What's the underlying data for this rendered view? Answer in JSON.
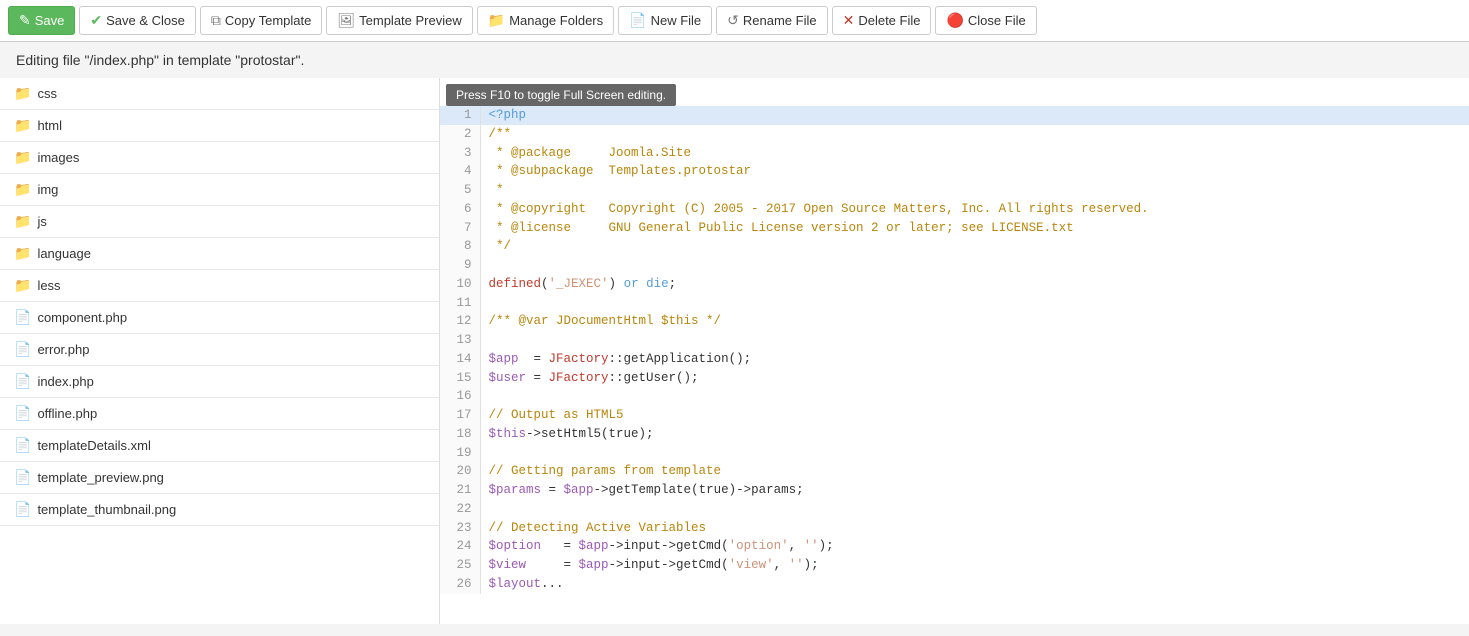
{
  "toolbar": {
    "save_label": "Save",
    "save_close_label": "Save & Close",
    "copy_template_label": "Copy Template",
    "template_preview_label": "Template Preview",
    "manage_folders_label": "Manage Folders",
    "new_file_label": "New File",
    "rename_file_label": "Rename File",
    "delete_file_label": "Delete File",
    "close_file_label": "Close File"
  },
  "editing_info": "Editing file \"/index.php\" in template \"protostar\".",
  "editor_hint": "Press F10 to toggle Full Screen editing.",
  "sidebar": {
    "folders": [
      {
        "name": "css"
      },
      {
        "name": "html"
      },
      {
        "name": "images"
      },
      {
        "name": "img"
      },
      {
        "name": "js"
      },
      {
        "name": "language"
      },
      {
        "name": "less"
      }
    ],
    "files": [
      {
        "name": "component.php"
      },
      {
        "name": "error.php"
      },
      {
        "name": "index.php"
      },
      {
        "name": "offline.php"
      },
      {
        "name": "templateDetails.xml"
      },
      {
        "name": "template_preview.png"
      },
      {
        "name": "template_thumbnail.png"
      }
    ]
  },
  "code_lines": [
    {
      "num": 1,
      "content": "<?php",
      "highlight": true
    },
    {
      "num": 2,
      "content": "/**"
    },
    {
      "num": 3,
      "content": " * @package     Joomla.Site"
    },
    {
      "num": 4,
      "content": " * @subpackage  Templates.protostar"
    },
    {
      "num": 5,
      "content": " *"
    },
    {
      "num": 6,
      "content": " * @copyright   Copyright (C) 2005 - 2017 Open Source Matters, Inc. All rights reserved."
    },
    {
      "num": 7,
      "content": " * @license     GNU General Public License version 2 or later; see LICENSE.txt"
    },
    {
      "num": 8,
      "content": " */"
    },
    {
      "num": 9,
      "content": ""
    },
    {
      "num": 10,
      "content": "defined('_JEXEC') or die;"
    },
    {
      "num": 11,
      "content": ""
    },
    {
      "num": 12,
      "content": "/** @var JDocumentHtml $this */"
    },
    {
      "num": 13,
      "content": ""
    },
    {
      "num": 14,
      "content": "$app  = JFactory::getApplication();"
    },
    {
      "num": 15,
      "content": "$user = JFactory::getUser();"
    },
    {
      "num": 16,
      "content": ""
    },
    {
      "num": 17,
      "content": "// Output as HTML5"
    },
    {
      "num": 18,
      "content": "$this->setHtml5(true);"
    },
    {
      "num": 19,
      "content": ""
    },
    {
      "num": 20,
      "content": "// Getting params from template"
    },
    {
      "num": 21,
      "content": "$params = $app->getTemplate(true)->params;"
    },
    {
      "num": 22,
      "content": ""
    },
    {
      "num": 23,
      "content": "// Detecting Active Variables"
    },
    {
      "num": 24,
      "content": "$option   = $app->input->getCmd('option', '');"
    },
    {
      "num": 25,
      "content": "$view     = $app->input->getCmd('view', '');"
    },
    {
      "num": 26,
      "content": "$layout..."
    }
  ]
}
